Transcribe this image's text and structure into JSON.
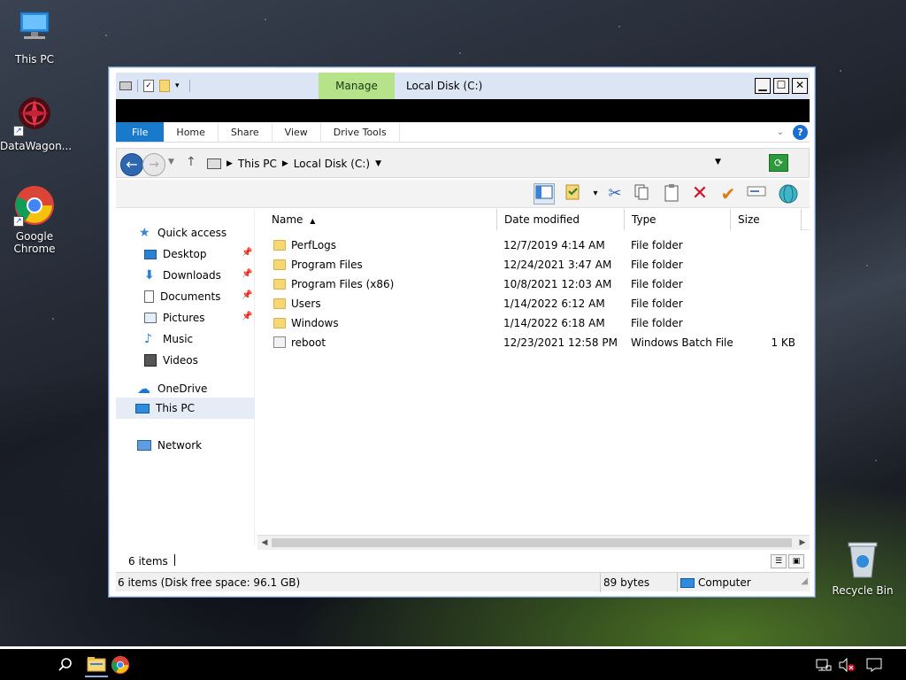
{
  "desktop": {
    "icons": [
      {
        "label": "This PC"
      },
      {
        "label": "DataWagon..."
      },
      {
        "label": "Google Chrome"
      },
      {
        "label": "Recycle Bin"
      }
    ]
  },
  "window": {
    "title": "Local Disk (C:)",
    "manage_tab": "Manage",
    "ribbon_tabs": [
      "File",
      "Home",
      "Share",
      "View",
      "Drive Tools"
    ],
    "address": {
      "segments": [
        "This PC",
        "Local Disk (C:)"
      ]
    },
    "nav": {
      "quick_access": "Quick access",
      "items": [
        {
          "label": "Desktop",
          "pinned": true
        },
        {
          "label": "Downloads",
          "pinned": true
        },
        {
          "label": "Documents",
          "pinned": true
        },
        {
          "label": "Pictures",
          "pinned": true
        },
        {
          "label": "Music",
          "pinned": false
        },
        {
          "label": "Videos",
          "pinned": false
        }
      ],
      "onedrive": "OneDrive",
      "this_pc": "This PC",
      "network": "Network"
    },
    "columns": [
      "Name",
      "Date modified",
      "Type",
      "Size"
    ],
    "files": [
      {
        "name": "PerfLogs",
        "date": "12/7/2019 4:14 AM",
        "type": "File folder",
        "size": "",
        "kind": "folder"
      },
      {
        "name": "Program Files",
        "date": "12/24/2021 3:47 AM",
        "type": "File folder",
        "size": "",
        "kind": "folder"
      },
      {
        "name": "Program Files (x86)",
        "date": "10/8/2021 12:03 AM",
        "type": "File folder",
        "size": "",
        "kind": "folder"
      },
      {
        "name": "Users",
        "date": "1/14/2022 6:12 AM",
        "type": "File folder",
        "size": "",
        "kind": "folder"
      },
      {
        "name": "Windows",
        "date": "1/14/2022 6:18 AM",
        "type": "File folder",
        "size": "",
        "kind": "folder"
      },
      {
        "name": "reboot",
        "date": "12/23/2021 12:58 PM",
        "type": "Windows Batch File",
        "size": "1 KB",
        "kind": "batch"
      }
    ],
    "item_count": "6 items",
    "status": {
      "left": "6 items (Disk free space: 96.1 GB)",
      "size": "89 bytes",
      "location": "Computer"
    }
  },
  "colors": {
    "file_tab": "#1979ca",
    "manage_tab": "#b6e28a",
    "titlebar": "#dbe5f3"
  }
}
